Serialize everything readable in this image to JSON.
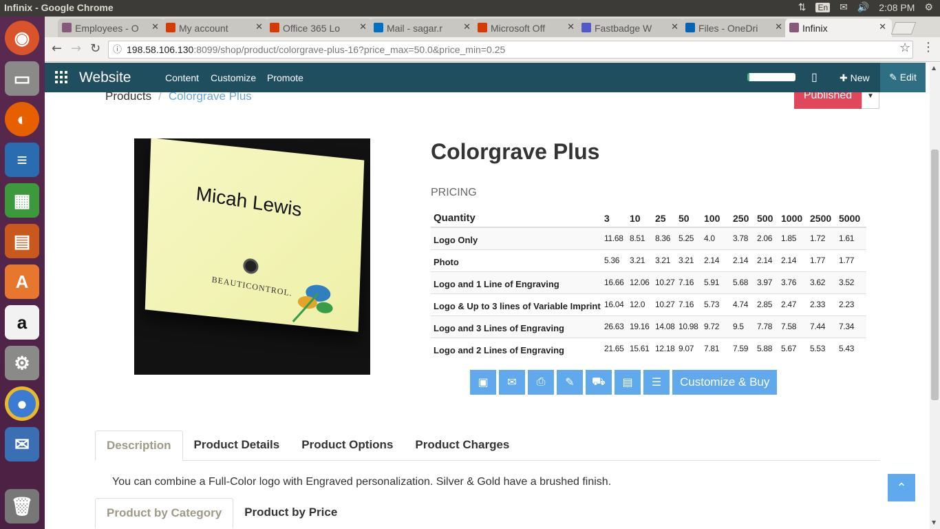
{
  "os": {
    "window_title": "Infinix - Google Chrome",
    "lang": "En",
    "clock": "2:08 PM"
  },
  "browser": {
    "tabs": [
      {
        "label": "Employees - O",
        "icon_color": "#875a7b"
      },
      {
        "label": "My account",
        "icon_color": "#d83b01"
      },
      {
        "label": "Office 365 Lo",
        "icon_color": "#d83b01"
      },
      {
        "label": "Mail - sagar.r",
        "icon_color": "#0072c6"
      },
      {
        "label": "Microsoft Off",
        "icon_color": "#d83b01"
      },
      {
        "label": "Fastbadge W",
        "icon_color": "#5059c9"
      },
      {
        "label": "Files - OneDri",
        "icon_color": "#0364b8"
      },
      {
        "label": "Infinix",
        "icon_color": "#875a7b"
      }
    ],
    "url_host": "198.58.106.130",
    "url_rest": ":8099/shop/product/colorgrave-plus-16?price_max=50.0&price_min=0.25"
  },
  "navbar": {
    "brand": "Website",
    "menu": [
      "Content",
      "Customize",
      "Promote"
    ],
    "new_label": "New",
    "edit_label": "Edit"
  },
  "breadcrumb": {
    "parent": "Products",
    "current": "Colorgrave Plus"
  },
  "publish": {
    "label": "Published"
  },
  "product": {
    "title": "Colorgrave Plus",
    "image_name": "Micah Lewis",
    "image_brand": "BEAUTICONTROL.",
    "pricing_label": "PRICING",
    "quantity_header": "Quantity",
    "quantities": [
      "3",
      "10",
      "25",
      "50",
      "100",
      "250",
      "500",
      "1000",
      "2500",
      "5000"
    ],
    "rows": [
      {
        "label": "Logo Only",
        "prices": [
          "11.68",
          "8.51",
          "8.36",
          "5.25",
          "4.0",
          "3.78",
          "2.06",
          "1.85",
          "1.72",
          "1.61"
        ]
      },
      {
        "label": "Photo",
        "prices": [
          "5.36",
          "3.21",
          "3.21",
          "3.21",
          "2.14",
          "2.14",
          "2.14",
          "2.14",
          "1.77",
          "1.77"
        ]
      },
      {
        "label": "Logo and 1 Line of Engraving",
        "prices": [
          "16.66",
          "12.06",
          "10.27",
          "7.16",
          "5.91",
          "5.68",
          "3.97",
          "3.76",
          "3.62",
          "3.52"
        ]
      },
      {
        "label": "Logo & Up to 3 lines of Variable Imprint",
        "prices": [
          "16.04",
          "12.0",
          "10.27",
          "7.16",
          "5.73",
          "4.74",
          "2.85",
          "2.47",
          "2.33",
          "2.23"
        ]
      },
      {
        "label": "Logo and 3 Lines of Engraving",
        "prices": [
          "26.63",
          "19.16",
          "14.08",
          "10.98",
          "9.72",
          "9.5",
          "7.78",
          "7.58",
          "7.44",
          "7.34"
        ]
      },
      {
        "label": "Logo and 2 Lines of Engraving",
        "prices": [
          "21.65",
          "15.61",
          "12.18",
          "9.07",
          "7.81",
          "7.59",
          "5.88",
          "5.67",
          "5.53",
          "5.43"
        ]
      }
    ],
    "actions": [
      "image-icon",
      "envelope-icon",
      "print-icon",
      "edit-icon",
      "truck-icon",
      "file-icon",
      "list-icon"
    ],
    "buy_label": "Customize & Buy"
  },
  "tabs": [
    "Description",
    "Product Details",
    "Product Options",
    "Product Charges"
  ],
  "description": "You can combine a Full-Color logo with Engraved personalization. Silver & Gold have a brushed finish.",
  "tabs2": [
    "Product by Category",
    "Product by Price"
  ],
  "colors": {
    "navbar": "#1f4e5f",
    "accent": "#5fa9ec",
    "published": "#e1475a"
  }
}
